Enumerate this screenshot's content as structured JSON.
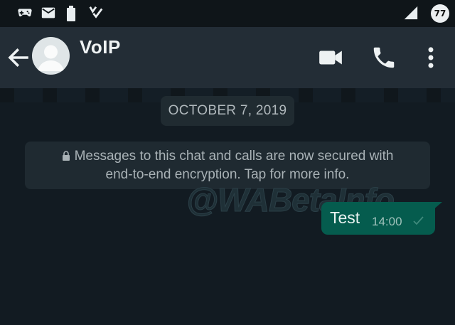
{
  "status_bar": {
    "icons": [
      "gamepad-icon",
      "mail-icon",
      "battery-icon",
      "checklist-icon",
      "signal-icon"
    ],
    "battery_level": "77"
  },
  "app_bar": {
    "title": "VoIP",
    "icons": [
      "back-arrow-icon",
      "avatar-icon",
      "video-call-icon",
      "voice-call-icon",
      "more-vert-icon"
    ]
  },
  "chat": {
    "date_label": "OCTOBER 7, 2019",
    "encryption_notice_line1": "Messages to this chat and calls are now secured with",
    "encryption_notice_line2": "end-to-end encryption. Tap for more info.",
    "watermark": "@WABetaInfo",
    "messages": [
      {
        "text": "Test",
        "time": "14:00",
        "status_icon": "sent-tick-icon"
      }
    ]
  },
  "colors": {
    "background": "#121b22",
    "app_bar": "#232d36",
    "outgoing_bubble": "#055c4e"
  }
}
